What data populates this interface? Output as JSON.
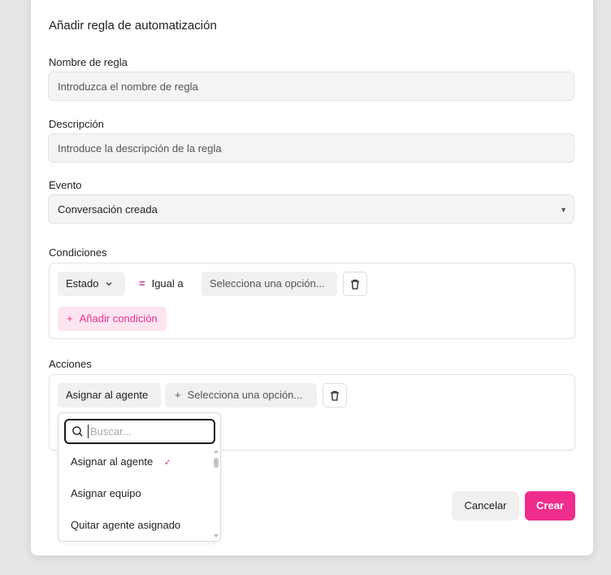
{
  "modal": {
    "title": "Añadir regla de automatización",
    "rule_name": {
      "label": "Nombre de regla",
      "placeholder": "Introduzca el nombre de regla"
    },
    "description": {
      "label": "Descripción",
      "placeholder": "Introduce la descripción de la regla"
    },
    "event": {
      "label": "Evento",
      "value": "Conversación creada"
    },
    "conditions": {
      "label": "Condiciones",
      "attribute": "Estado",
      "operator_symbol": "=",
      "operator": "Igual a",
      "value_placeholder": "Selecciona una opción...",
      "add_button": "Añadir condición",
      "add_icon": "+"
    },
    "actions": {
      "label": "Acciones",
      "action": "Asignar al agente",
      "value_placeholder": "Selecciona una opción...",
      "add_icon": "+"
    },
    "dropdown": {
      "search_placeholder": "Buscar...",
      "items": [
        {
          "label": "Asignar al agente",
          "selected": true
        },
        {
          "label": "Asignar equipo",
          "selected": false
        },
        {
          "label": "Quitar agente asignado",
          "selected": false
        }
      ],
      "check_icon": "✓"
    },
    "footer": {
      "cancel": "Cancelar",
      "create": "Crear"
    }
  },
  "colors": {
    "accent": "#f02c8c",
    "accent_soft": "#fde4f1",
    "field_bg": "#f4f4f4"
  }
}
